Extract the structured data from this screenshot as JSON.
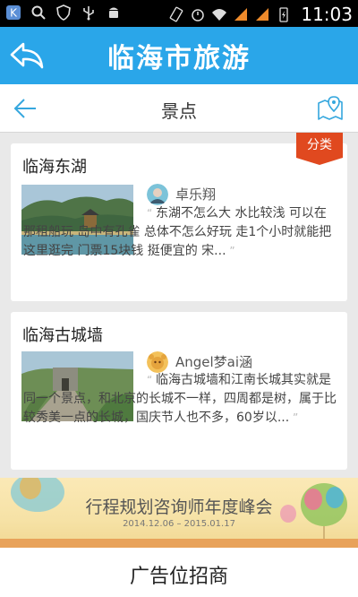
{
  "status_bar": {
    "time": "11:03",
    "icons": [
      "k-app-icon",
      "search-icon",
      "shield-icon",
      "usb-icon",
      "android-icon",
      "rotate-icon",
      "alarm-icon",
      "wifi-icon",
      "signal-icon",
      "signal-icon-2",
      "battery-charging-icon"
    ]
  },
  "header": {
    "title": "临海市旅游",
    "back_icon": "reply-arrow-icon"
  },
  "sub_header": {
    "title": "景点",
    "back_icon": "arrow-left-icon",
    "map_icon": "map-pin-icon"
  },
  "category_tag": {
    "label": "分类",
    "color": "#e0491f"
  },
  "spots": [
    {
      "title": "临海东湖",
      "user": "卓乐翔",
      "snippet": "东湖不怎么大 水比较浅 可以在那租船玩 岛中有孔雀 总体不怎么好玩 走1个小时就能把这里逛完 门票15块钱 挺便宜的 宋..."
    },
    {
      "title": "临海古城墙",
      "user": "Angel梦ai涵",
      "snippet": "临海古城墙和江南长城其实就是同一个景点，和北京的长城不一样，四周都是树，属于比较秀美一点的长城，国庆节人也不多，60岁以..."
    }
  ],
  "banner": {
    "title": "行程规划咨询师年度峰会",
    "date": "2014.12.06 – 2015.01.17"
  },
  "ad": {
    "text": "广告位招商"
  },
  "colors": {
    "header_blue": "#2aa6e9",
    "accent_blue": "#35a7de"
  }
}
